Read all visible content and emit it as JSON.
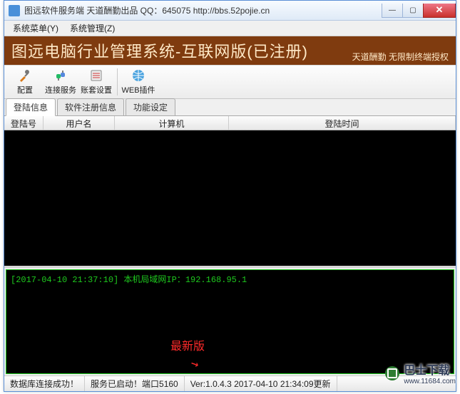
{
  "window": {
    "title": "图远软件服务端 天道酬勤出品 QQ：645075 http://bbs.52pojie.cn",
    "controls": {
      "minimize": "—",
      "maximize": "▢",
      "close": "✕"
    }
  },
  "menubar": {
    "items": [
      "系统菜单(Y)",
      "系统管理(Z)"
    ]
  },
  "banner": {
    "title": "图远电脑行业管理系统-互联网版(已注册)",
    "right": "天道酬勤  无限制终端授权"
  },
  "toolbar": {
    "config": "配置",
    "connect": "连接服务",
    "account": "账套设置",
    "webplugin": "WEB插件"
  },
  "tabs": {
    "login_info": "登陆信息",
    "reg_info": "软件注册信息",
    "func_set": "功能设定"
  },
  "grid": {
    "columns": {
      "login_no": "登陆号",
      "username": "用户名",
      "computer": "计算机",
      "login_time": "登陆时间"
    }
  },
  "console": {
    "line1": "[2017-04-10 21:37:10] 本机局域网IP：192.168.95.1"
  },
  "annotation": {
    "text": "最新版"
  },
  "status": {
    "db": "数据库连接成功！",
    "svc": "服务已启动！端口5160",
    "ver": "Ver:1.0.4.3 2017-04-10 21:34:09更新"
  },
  "watermark": {
    "text": "巴士下载",
    "url": "www.11684.com"
  }
}
